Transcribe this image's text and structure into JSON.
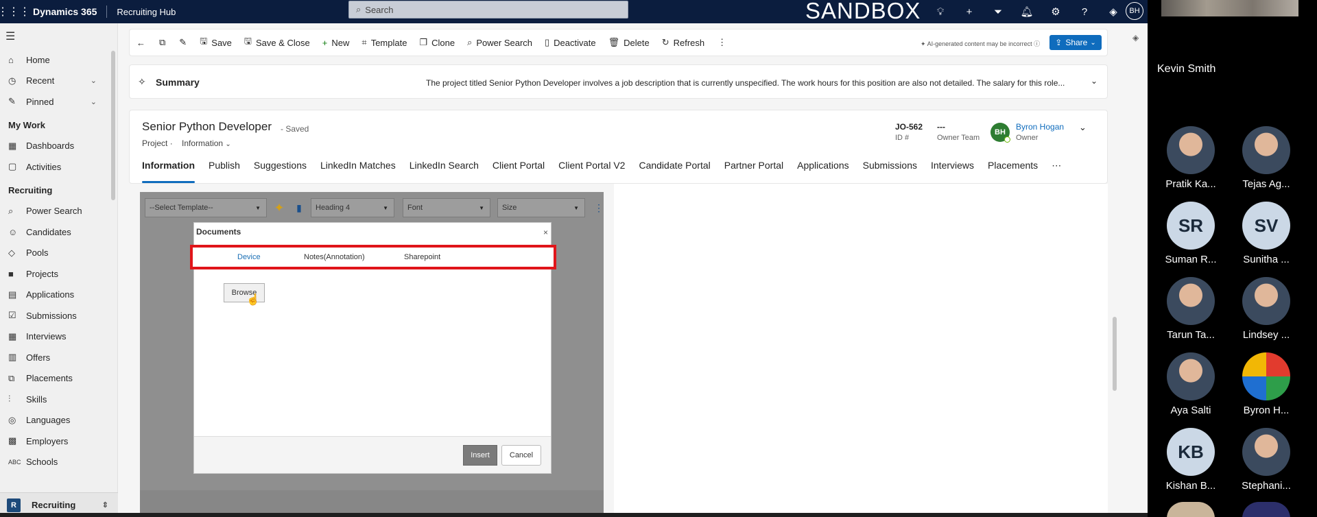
{
  "topbar": {
    "app_name": "Dynamics 365",
    "hub_name": "Recruiting Hub",
    "search_placeholder": "Search",
    "env_label": "SANDBOX",
    "user_initials": "BH"
  },
  "nav": {
    "items_top": [
      {
        "label": "Home",
        "icon": "home-icon"
      },
      {
        "label": "Recent",
        "icon": "clock-icon"
      },
      {
        "label": "Pinned",
        "icon": "pin-icon"
      }
    ],
    "section_mywork": "My Work",
    "items_mywork": [
      {
        "label": "Dashboards",
        "icon": "dashboard-icon"
      },
      {
        "label": "Activities",
        "icon": "activities-icon"
      }
    ],
    "section_recruiting": "Recruiting",
    "items_recruiting": [
      {
        "label": "Power Search",
        "icon": "search-icon"
      },
      {
        "label": "Candidates",
        "icon": "person-icon"
      },
      {
        "label": "Pools",
        "icon": "pool-icon"
      },
      {
        "label": "Projects",
        "icon": "briefcase-icon"
      },
      {
        "label": "Applications",
        "icon": "document-icon"
      },
      {
        "label": "Submissions",
        "icon": "submission-icon"
      },
      {
        "label": "Interviews",
        "icon": "calendar-icon"
      },
      {
        "label": "Offers",
        "icon": "offer-icon"
      },
      {
        "label": "Placements",
        "icon": "placement-icon"
      },
      {
        "label": "Skills",
        "icon": "skills-icon"
      },
      {
        "label": "Languages",
        "icon": "globe-icon"
      },
      {
        "label": "Employers",
        "icon": "building-icon"
      },
      {
        "label": "Schools",
        "icon": "abc-icon"
      }
    ],
    "area_switcher": {
      "badge": "R",
      "label": "Recruiting"
    }
  },
  "commandbar": {
    "save": "Save",
    "save_close": "Save & Close",
    "new": "New",
    "template": "Template",
    "clone": "Clone",
    "power_search": "Power Search",
    "deactivate": "Deactivate",
    "delete": "Delete",
    "refresh": "Refresh",
    "ai_note": "AI-generated content may be incorrect",
    "share": "Share"
  },
  "summary": {
    "title": "Summary",
    "text": "The project titled Senior Python Developer involves a job description that is currently unspecified. The work hours for this position are also not detailed. The salary for this role..."
  },
  "record": {
    "title": "Senior Python Developer",
    "saved": "- Saved",
    "entity": "Project",
    "form": "Information",
    "id_value": "JO-562",
    "id_label": "ID #",
    "team_value": "---",
    "team_label": "Owner Team",
    "owner_initials": "BH",
    "owner_name": "Byron Hogan",
    "owner_label": "Owner"
  },
  "tabs": [
    "Information",
    "Publish",
    "Suggestions",
    "LinkedIn Matches",
    "LinkedIn Search",
    "Client Portal",
    "Client Portal V2",
    "Candidate Portal",
    "Partner Portal",
    "Applications",
    "Submissions",
    "Interviews",
    "Placements"
  ],
  "editor_toolbar": {
    "template_select": "--Select Template--",
    "heading_select": "Heading 4",
    "font_select": "Font",
    "size_select": "Size"
  },
  "dialog": {
    "title": "Documents",
    "close": "×",
    "tab_device": "Device",
    "tab_notes": "Notes(Annotation)",
    "tab_sharepoint": "Sharepoint",
    "browse": "Browse",
    "insert": "Insert",
    "cancel": "Cancel"
  },
  "meeting": {
    "speaker": "Kevin Smith",
    "participants": [
      {
        "name": "Pratik Ka...",
        "initials": ""
      },
      {
        "name": "Tejas Ag...",
        "initials": ""
      },
      {
        "name": "Suman R...",
        "initials": "SR"
      },
      {
        "name": "Sunitha ...",
        "initials": "SV"
      },
      {
        "name": "Tarun Ta...",
        "initials": ""
      },
      {
        "name": "Lindsey ...",
        "initials": ""
      },
      {
        "name": "Aya Salti",
        "initials": ""
      },
      {
        "name": "Byron H...",
        "initials": ""
      },
      {
        "name": "Kishan B...",
        "initials": "KB"
      },
      {
        "name": "Stephani...",
        "initials": ""
      }
    ]
  },
  "colors": {
    "topbar_bg": "#0b1d3e",
    "accent": "#0f6cbd",
    "highlight_border": "#e0151a"
  }
}
